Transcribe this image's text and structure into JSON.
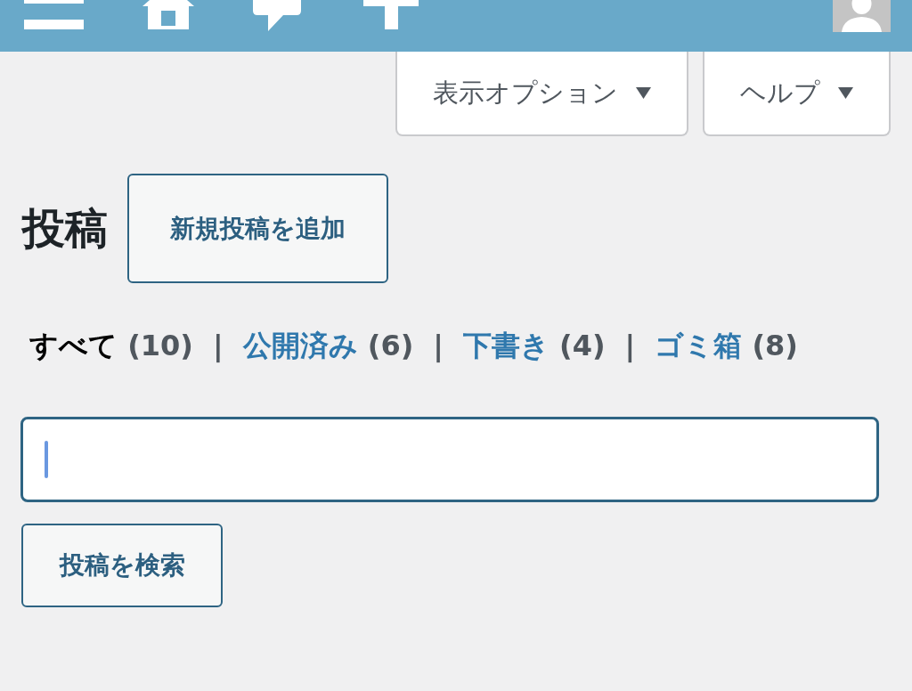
{
  "screen_tabs": [
    {
      "label": "表示オプション",
      "expanded": false
    },
    {
      "label": "ヘルプ",
      "expanded": false
    }
  ],
  "page_title": "投稿",
  "add_button": "新規投稿を追加",
  "filters": [
    {
      "label": "すべて",
      "count": "(10)",
      "selected": true,
      "separator": "|"
    },
    {
      "label": "公開済み",
      "count": "(6)",
      "selected": false,
      "separator": "|"
    },
    {
      "label": "下書き",
      "count": "(4)",
      "selected": false,
      "separator": "|"
    },
    {
      "label": "ゴミ箱",
      "count": "(8)",
      "selected": false
    }
  ],
  "search": {
    "focused": true,
    "button": "投稿を検索"
  }
}
